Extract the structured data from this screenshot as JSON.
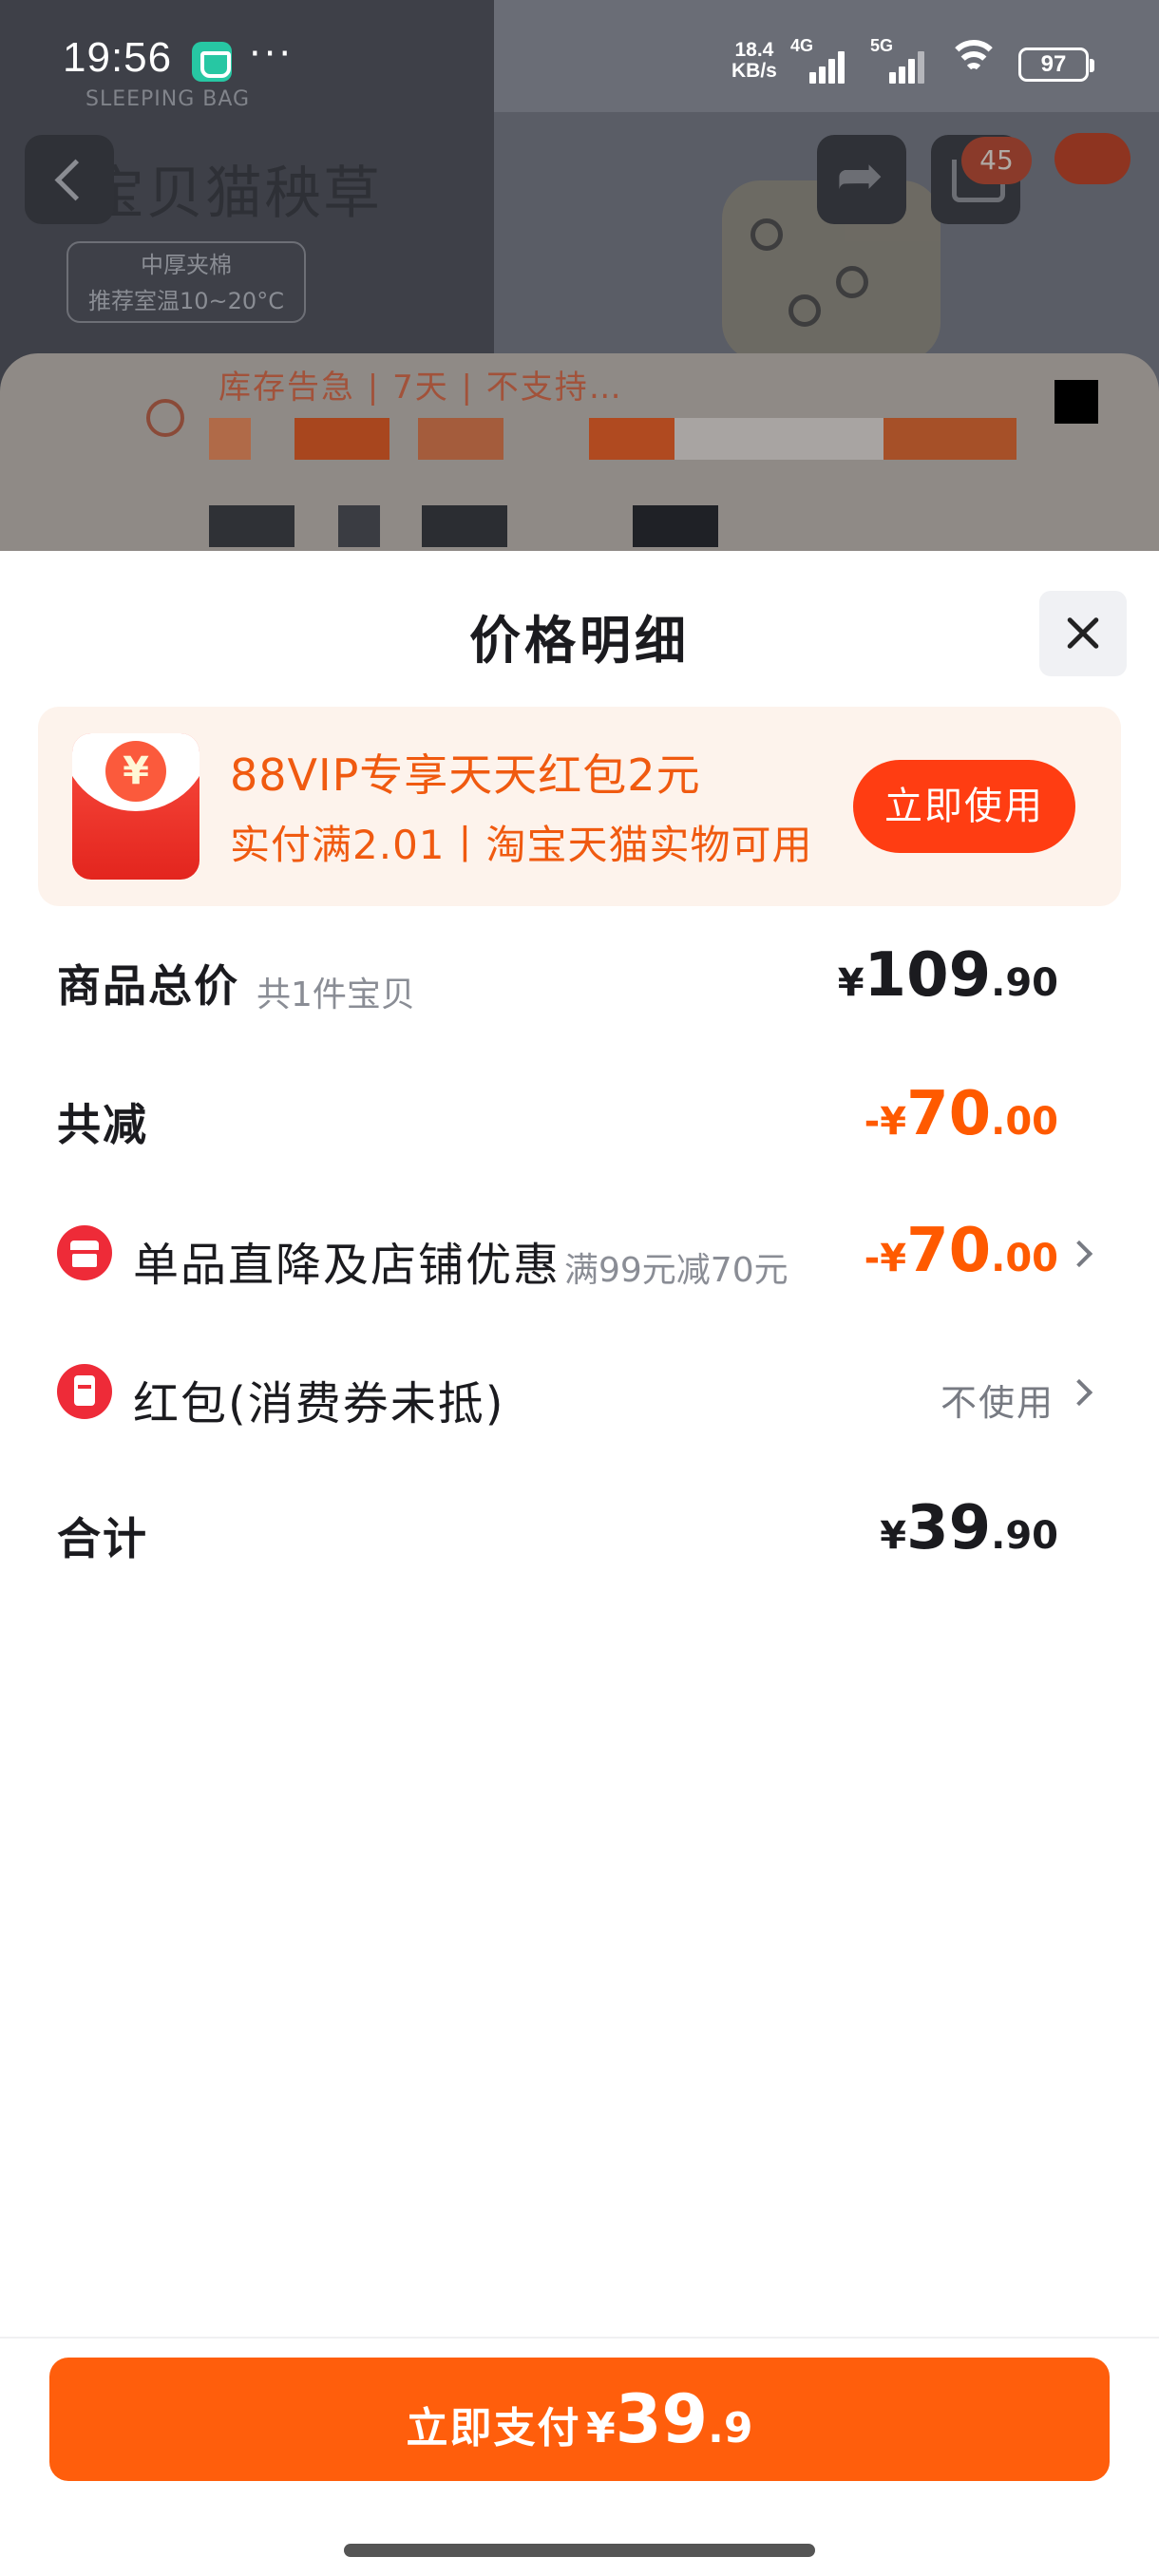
{
  "status_bar": {
    "time": "19:56",
    "more": "···",
    "net_speed_value": "18.4",
    "net_speed_unit": "KB/s",
    "signal_1": "4G",
    "signal_2": "5G",
    "battery": "97"
  },
  "background": {
    "sub": "SLEEPING BAG",
    "brand": "宝贝猫秧草",
    "tag_line1": "中厚夹棉",
    "tag_line2": "推荐室温10~20°C",
    "cart_count": "45",
    "card_text": "库存告急 | 7天 | 不支持…"
  },
  "sheet": {
    "title": "价格明细",
    "vip_banner": {
      "line1": "88VIP专享天天红包2元",
      "line2": "实付满2.01丨淘宝天猫实物可用",
      "button": "立即使用",
      "icon_glyph": "¥"
    },
    "rows": {
      "total": {
        "label": "商品总价",
        "sub": "共1件宝贝",
        "currency": "¥",
        "int": "109",
        "dec": ".90"
      },
      "reduce": {
        "label": "共减",
        "minus": "-",
        "currency": "¥",
        "int": "70",
        "dec": ".00"
      },
      "shop_discount": {
        "label": "单品直降及店铺优惠",
        "sub": "满99元减70元",
        "minus": "-",
        "currency": "¥",
        "int": "70",
        "dec": ".00"
      },
      "red_packet": {
        "label": "红包(消费券未抵)",
        "value": "不使用"
      },
      "sum": {
        "label": "合计",
        "currency": "¥",
        "int": "39",
        "dec": ".90"
      }
    },
    "pay": {
      "label": "立即支付",
      "currency": "¥",
      "int": "39",
      "dec": ".9"
    }
  },
  "colors": {
    "accent_orange": "#ff5e0c",
    "vip_text": "#f05a10",
    "discount_text": "#ff5a00",
    "red_packet": "#ee2b38"
  }
}
